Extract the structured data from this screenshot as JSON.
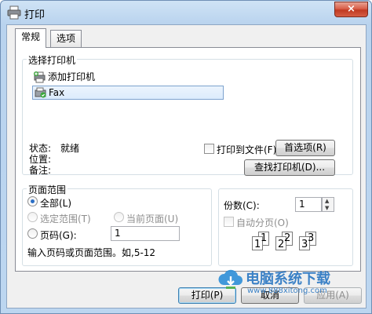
{
  "window": {
    "title": "打印",
    "close_symbol": "×"
  },
  "tabs": [
    {
      "label": "常规",
      "active": true
    },
    {
      "label": "选项",
      "active": false
    }
  ],
  "printer_group": {
    "title": "选择打印机",
    "items": [
      {
        "label": "添加打印机",
        "icon": "add-printer-icon",
        "selected": false
      },
      {
        "label": "Fax",
        "icon": "fax-printer-icon",
        "selected": true
      }
    ],
    "status_label": "状态:",
    "status_value": "就绪",
    "location_label": "位置:",
    "comment_label": "备注:",
    "print_to_file_label": "打印到文件(F)",
    "preferences_button": "首选项(R)",
    "find_printer_button": "查找打印机(D)..."
  },
  "page_range": {
    "title": "页面范围",
    "all_label": "全部(L)",
    "selection_label": "选定范围(T)",
    "current_page_label": "当前页面(U)",
    "pages_label": "页码(G):",
    "pages_value": "1",
    "hint": "输入页码或页面范围。如,5-12"
  },
  "copies": {
    "label": "份数(C):",
    "value": "1",
    "collate_label": "自动分页(O)",
    "collate_pages": [
      "1",
      "1",
      "2",
      "2",
      "3",
      "3"
    ]
  },
  "buttons": {
    "print": "打印(P)",
    "cancel": "取消",
    "apply": "应用(A)"
  },
  "watermark": {
    "brand": "电脑系统下载",
    "url": "www.888xitong.com"
  },
  "colors": {
    "accent": "#2b6fc6",
    "close_button": "#c8462f",
    "watermark": "#2876c2"
  }
}
